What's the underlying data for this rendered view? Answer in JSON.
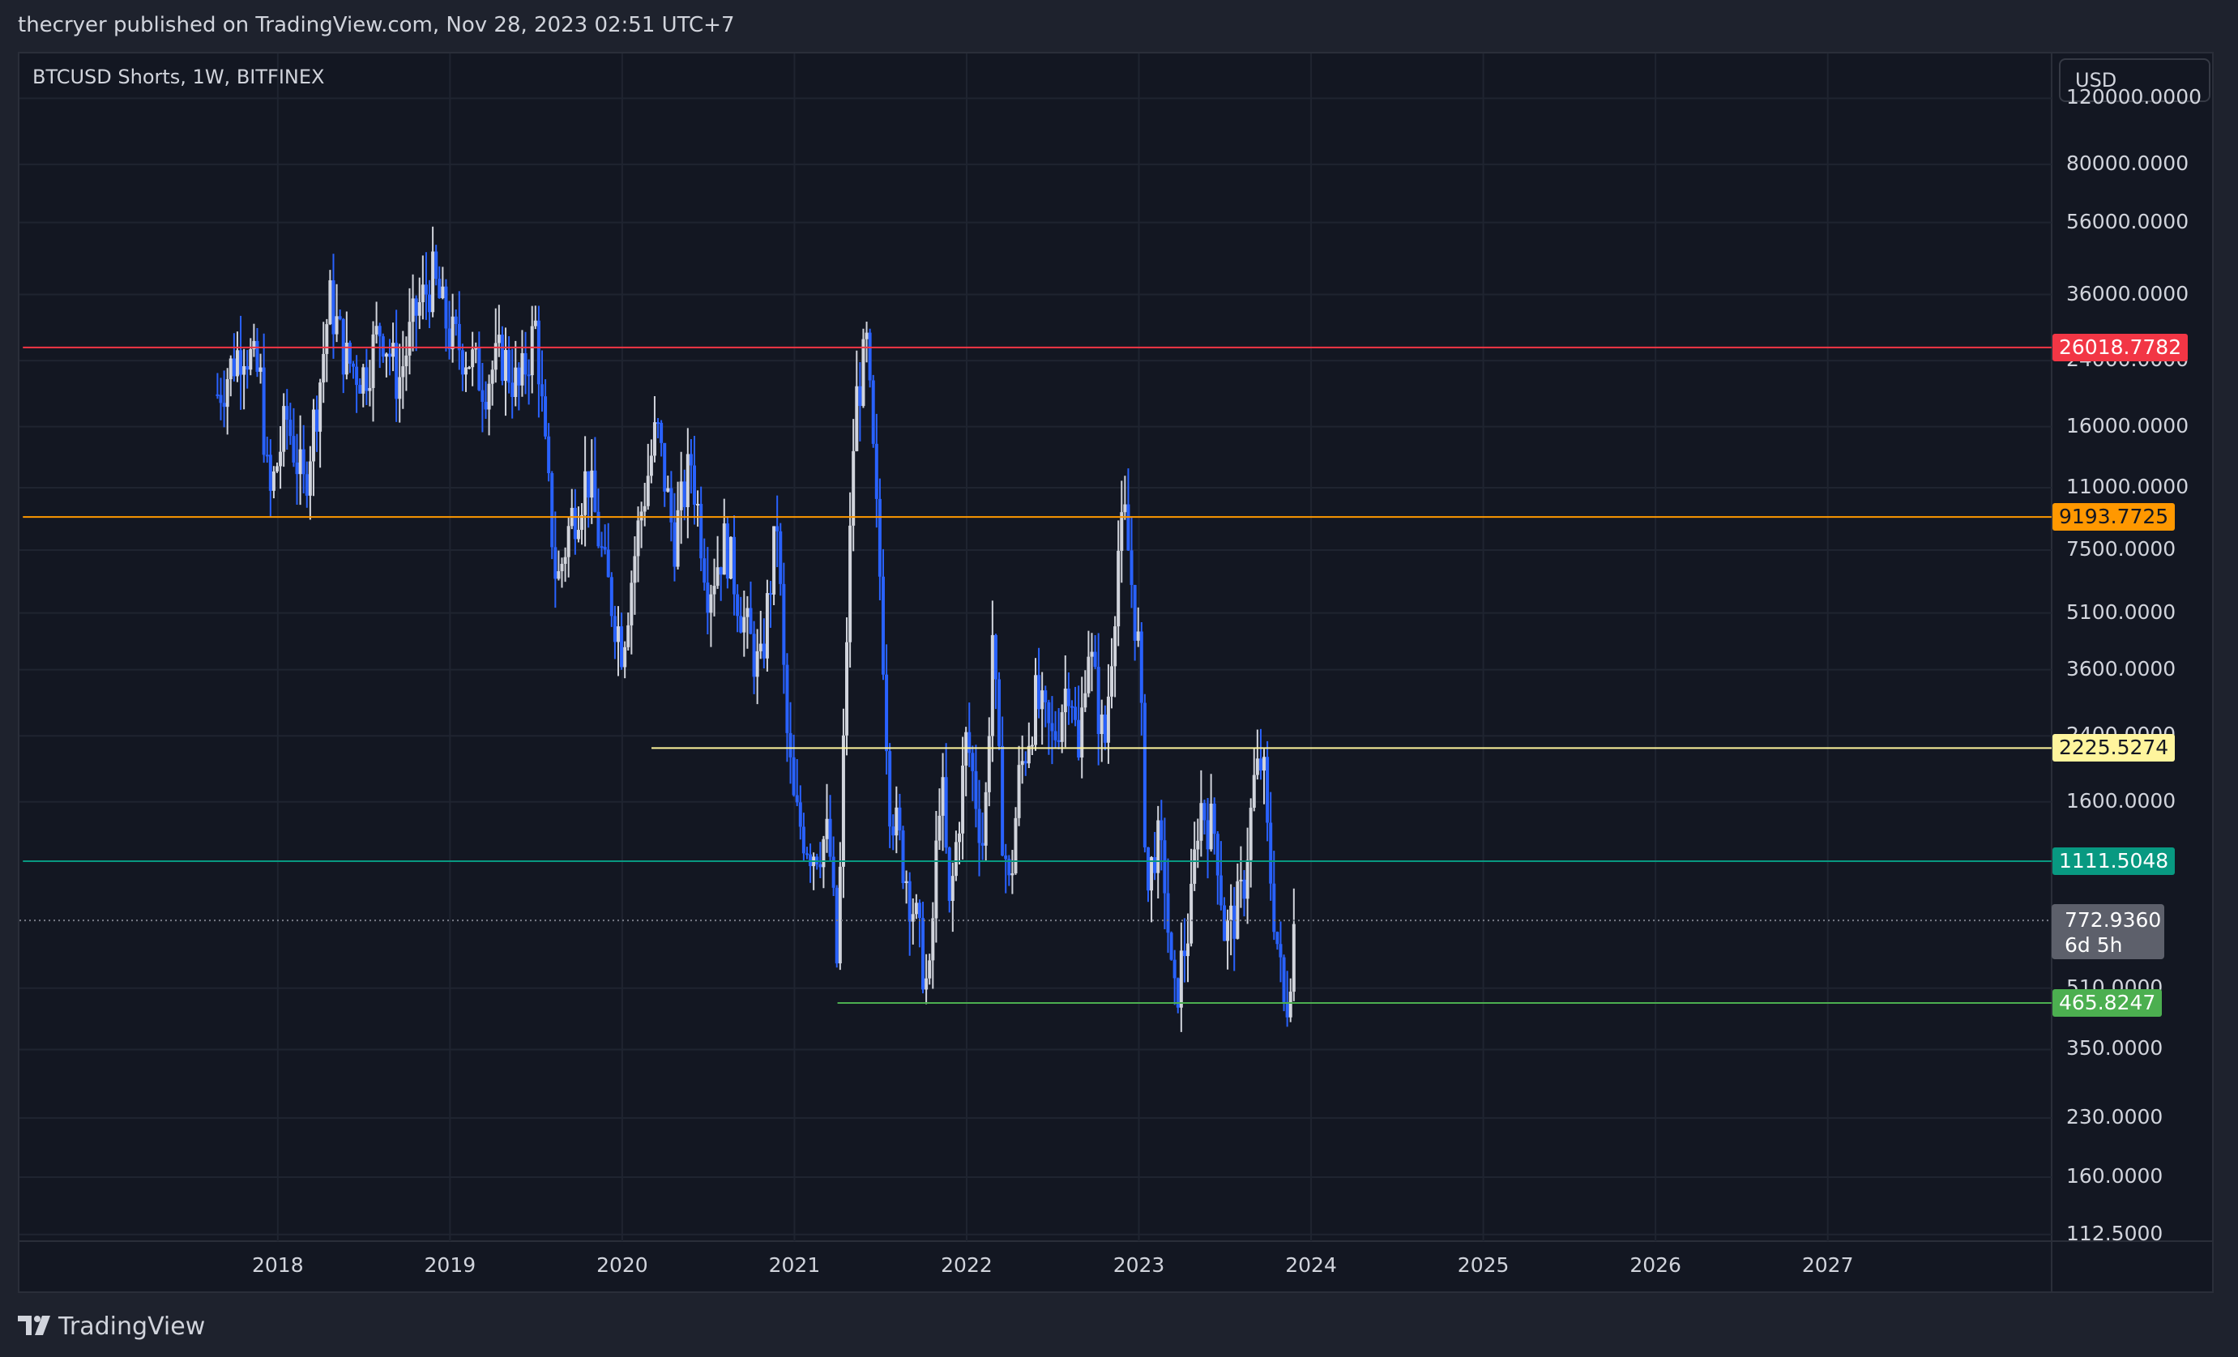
{
  "header": {
    "publish_line": "thecryer published on TradingView.com, Nov 28, 2023 02:51 UTC+7"
  },
  "chart": {
    "symbol_line": "BTCUSD Shorts, 1W, BITFINEX",
    "currency": "USD"
  },
  "footer": {
    "brand": "TradingView"
  },
  "chart_data": {
    "type": "candlestick",
    "title": "BTCUSD Shorts, 1W, BITFINEX",
    "y_scale": "log",
    "y_ticks": [
      "120000.0000",
      "80000.0000",
      "56000.0000",
      "36000.0000",
      "24000.0000",
      "16000.0000",
      "11000.0000",
      "7500.0000",
      "5100.0000",
      "3600.0000",
      "2400.0000",
      "1600.0000",
      "510.0000",
      "350.0000",
      "230.0000",
      "160.0000",
      "112.5000"
    ],
    "x_ticks": [
      "2018",
      "2019",
      "2020",
      "2021",
      "2022",
      "2023",
      "2024",
      "2025",
      "2026",
      "2027"
    ],
    "x_range": [
      2016.5,
      2028.3
    ],
    "y_range": [
      108,
      158000
    ],
    "grid": true,
    "horizontal_lines": [
      {
        "price": 26018.7782,
        "label": "26018.7782",
        "color": "#f23645",
        "text_color": "#ffffff",
        "x_start": 2016.52
      },
      {
        "price": 9193.7725,
        "label": "9193.7725",
        "color": "#ff9800",
        "text_color": "#131722",
        "x_start": 2016.52
      },
      {
        "price": 2225.5274,
        "label": "2225.5274",
        "color": "#fff59d",
        "text_color": "#131722",
        "x_start": 2020.17
      },
      {
        "price": 1111.5048,
        "label": "1111.5048",
        "color": "#089981",
        "text_color": "#ffffff",
        "x_start": 2016.52
      },
      {
        "price": 465.8247,
        "label": "465.8247",
        "color": "#4caf50",
        "text_color": "#ffffff",
        "x_start": 2021.25
      }
    ],
    "current_price": {
      "value": 772.936,
      "label": "772.9360",
      "countdown": "6d 5h"
    },
    "series": [
      {
        "name": "BTCUSD Shorts",
        "period": "1W",
        "points": [
          [
            2017.65,
            19500
          ],
          [
            2017.8,
            27000
          ],
          [
            2017.9,
            21000
          ],
          [
            2017.95,
            10000
          ],
          [
            2018.05,
            17000
          ],
          [
            2018.15,
            11000
          ],
          [
            2018.25,
            22000
          ],
          [
            2018.3,
            35000
          ],
          [
            2018.4,
            24000
          ],
          [
            2018.5,
            22000
          ],
          [
            2018.6,
            30000
          ],
          [
            2018.7,
            21000
          ],
          [
            2018.8,
            32000
          ],
          [
            2018.9,
            40000
          ],
          [
            2019.0,
            28000
          ],
          [
            2019.1,
            25000
          ],
          [
            2019.2,
            21000
          ],
          [
            2019.3,
            25000
          ],
          [
            2019.4,
            20000
          ],
          [
            2019.5,
            30000
          ],
          [
            2019.55,
            14000
          ],
          [
            2019.62,
            6000
          ],
          [
            2019.7,
            9000
          ],
          [
            2019.8,
            12000
          ],
          [
            2019.9,
            6500
          ],
          [
            2020.0,
            4200
          ],
          [
            2020.1,
            9000
          ],
          [
            2020.2,
            16000
          ],
          [
            2020.3,
            8000
          ],
          [
            2020.4,
            13000
          ],
          [
            2020.5,
            6000
          ],
          [
            2020.6,
            8000
          ],
          [
            2020.7,
            5000
          ],
          [
            2020.8,
            3500
          ],
          [
            2020.9,
            9000
          ],
          [
            2020.95,
            2600
          ],
          [
            2021.0,
            1500
          ],
          [
            2021.1,
            1200
          ],
          [
            2021.2,
            1300
          ],
          [
            2021.25,
            560
          ],
          [
            2021.3,
            4000
          ],
          [
            2021.35,
            18000
          ],
          [
            2021.42,
            26000
          ],
          [
            2021.5,
            6000
          ],
          [
            2021.55,
            1700
          ],
          [
            2021.6,
            1300
          ],
          [
            2021.7,
            800
          ],
          [
            2021.78,
            480
          ],
          [
            2021.85,
            2000
          ],
          [
            2021.9,
            800
          ],
          [
            2022.0,
            2400
          ],
          [
            2022.1,
            1200
          ],
          [
            2022.15,
            4500
          ],
          [
            2022.2,
            1500
          ],
          [
            2022.25,
            900
          ],
          [
            2022.3,
            1800
          ],
          [
            2022.4,
            3000
          ],
          [
            2022.5,
            2300
          ],
          [
            2022.6,
            3600
          ],
          [
            2022.65,
            2000
          ],
          [
            2022.7,
            4500
          ],
          [
            2022.8,
            2200
          ],
          [
            2022.88,
            7500
          ],
          [
            2022.92,
            9000
          ],
          [
            2023.0,
            4000
          ],
          [
            2023.05,
            900
          ],
          [
            2023.1,
            1300
          ],
          [
            2023.15,
            1000
          ],
          [
            2023.2,
            450
          ],
          [
            2023.3,
            800
          ],
          [
            2023.35,
            1600
          ],
          [
            2023.45,
            1300
          ],
          [
            2023.5,
            700
          ],
          [
            2023.6,
            900
          ],
          [
            2023.67,
            1800
          ],
          [
            2023.72,
            2100
          ],
          [
            2023.75,
            1200
          ],
          [
            2023.8,
            700
          ],
          [
            2023.85,
            420
          ],
          [
            2023.9,
            750
          ]
        ]
      }
    ]
  }
}
